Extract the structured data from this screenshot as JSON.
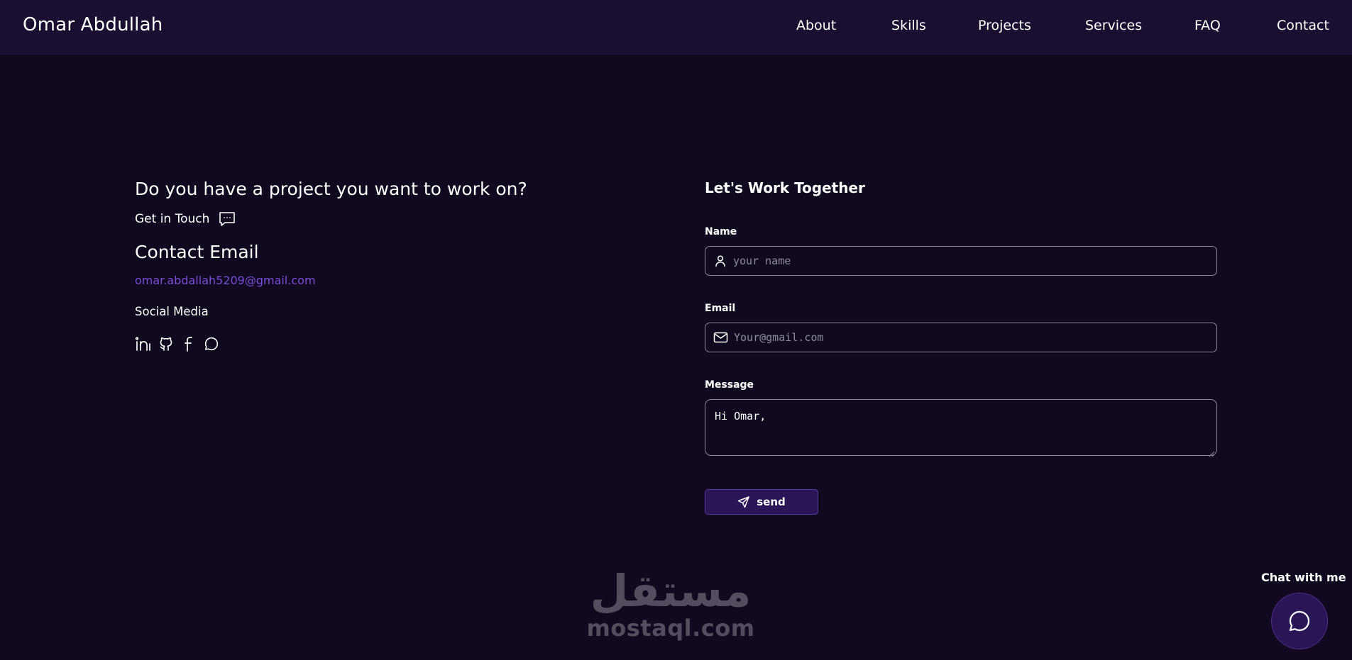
{
  "header": {
    "brand": "Omar Abdullah",
    "nav": [
      "About",
      "Skills",
      "Projects",
      "Services",
      "FAQ",
      "Contact"
    ]
  },
  "contact": {
    "headline": "Do you have a project you want to work on?",
    "get_in_touch": "Get in Touch",
    "email_title": "Contact Email",
    "email": "omar.abdallah5209@gmail.com",
    "social_title": "Social Media",
    "social_icons": [
      "linkedin-icon",
      "github-icon",
      "facebook-icon",
      "whatsapp-icon"
    ]
  },
  "form": {
    "title": "Let's Work Together",
    "name_label": "Name",
    "name_placeholder": "your name",
    "email_label": "Email",
    "email_placeholder": "Your@gmail.com",
    "message_label": "Message",
    "message_value": "Hi Omar,",
    "send_label": "send"
  },
  "watermark": {
    "arabic": "مستقل",
    "latin": "mostaql.com"
  },
  "chat": {
    "label": "Chat with me"
  },
  "colors": {
    "background": "#10091f",
    "header": "#1a0f30",
    "accent": "#7c4ddb",
    "button": "#2a1657"
  }
}
